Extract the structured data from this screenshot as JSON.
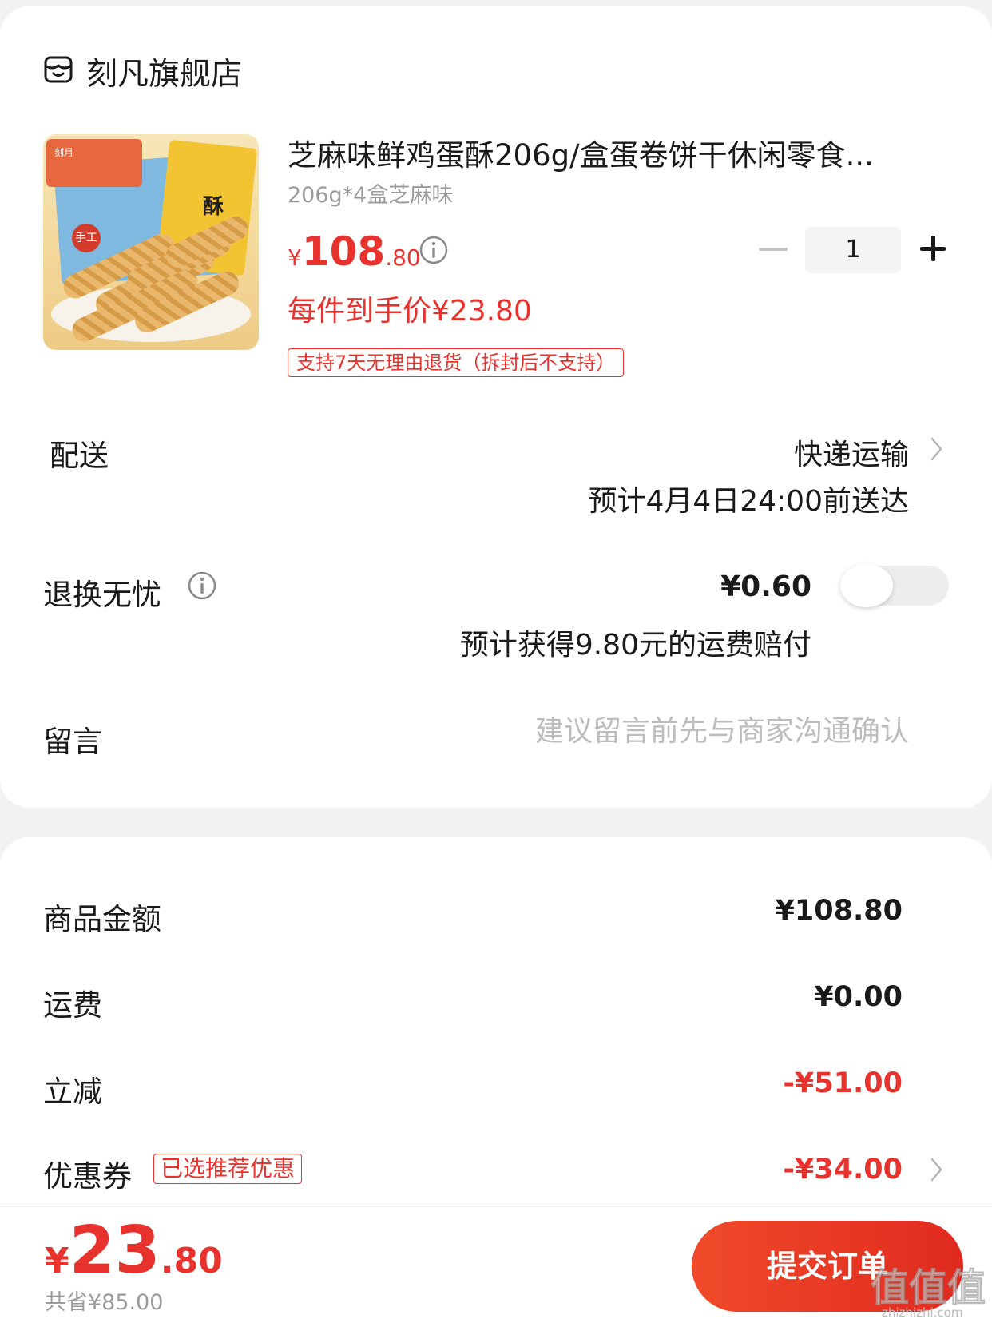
{
  "store": {
    "name": "刻凡旗舰店",
    "icon": "store-icon"
  },
  "product": {
    "title": "芝麻味鲜鸡蛋酥206g/盒蛋卷饼干休闲零食...",
    "spec": "206g*4盒芝麻味",
    "price_symbol": "¥",
    "price_int": "108",
    "price_dec": ".80",
    "each_price": "每件到手价¥23.80",
    "return_tag": "支持7天无理由退货（拆封后不支持）",
    "quantity": "1",
    "image_labels": {
      "brand": "刻月",
      "stamp": "手工",
      "flavor": "酥"
    }
  },
  "delivery": {
    "label": "配送",
    "method": "快递运输",
    "eta": "预计4月4日24:00前送达"
  },
  "return_insurance": {
    "label": "退换无忧",
    "price": "¥0.60",
    "enabled": false,
    "note": "预计获得9.80元的运费赔付"
  },
  "message": {
    "label": "留言",
    "placeholder": "建议留言前先与商家沟通确认"
  },
  "summary": {
    "goods_label": "商品金额",
    "goods_value": "¥108.80",
    "shipping_label": "运费",
    "shipping_value": "¥0.00",
    "discount_label": "立减",
    "discount_value": "-¥51.00",
    "coupon_label": "优惠券",
    "coupon_tag": "已选推荐优惠",
    "coupon_value": "-¥34.00"
  },
  "footer": {
    "total_symbol": "¥",
    "total_int": "23",
    "total_dec": ".80",
    "saved": "共省¥85.00",
    "submit_label": "提交订单",
    "watermark": "值值值",
    "watermark_url": "zhizhizhi.com"
  },
  "colors": {
    "accent": "#e8322e",
    "muted": "#9b9b9b",
    "background": "#f2f2f2"
  }
}
